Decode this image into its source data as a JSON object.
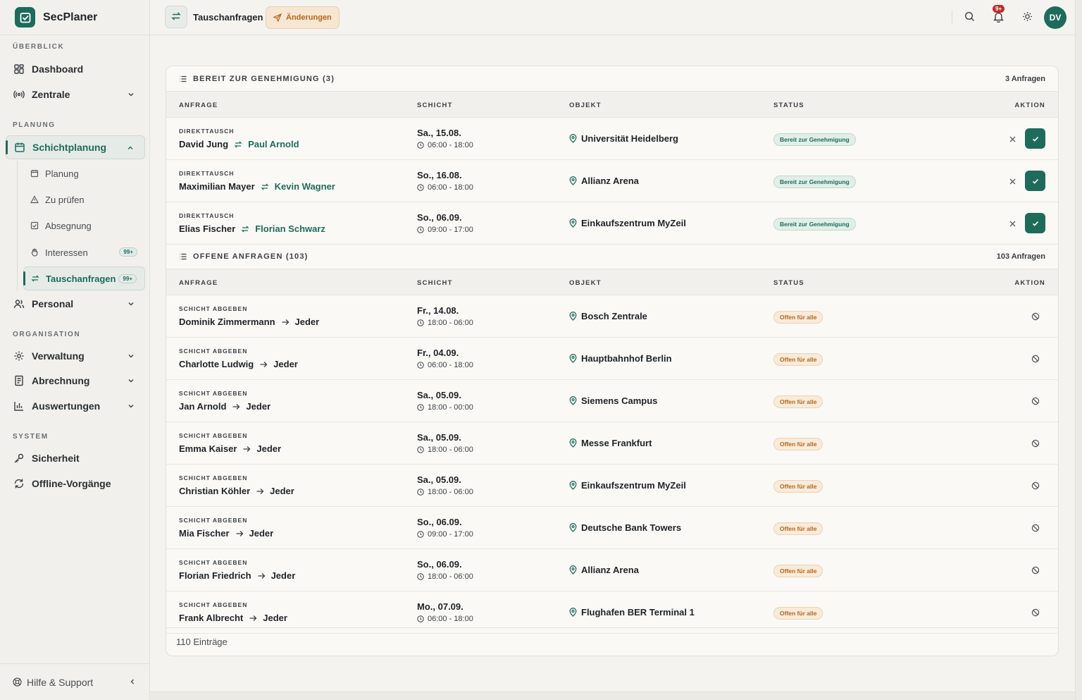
{
  "app": {
    "name": "SecPlaner"
  },
  "sidebar": {
    "sections": [
      {
        "label": "ÜBERBLICK"
      },
      {
        "label": "PLANUNG"
      },
      {
        "label": "ORGANISATION"
      },
      {
        "label": "SYSTEM"
      }
    ],
    "items": {
      "dashboard": "Dashboard",
      "zentrale": "Zentrale",
      "schichtplanung": "Schichtplanung",
      "personal": "Personal",
      "verwaltung": "Verwaltung",
      "abrechnung": "Abrechnung",
      "auswertungen": "Auswertungen",
      "sicherheit": "Sicherheit",
      "offline": "Offline-Vorgänge"
    },
    "subitems": {
      "planung": "Planung",
      "zu_pruefen": "Zu prüfen",
      "absegnung": "Absegnung",
      "interessen": "Interessen",
      "interessen_badge": "99+",
      "tauschanfragen": "Tauschanfragen",
      "tauschanfragen_badge": "99+"
    },
    "help": "Hilfe & Support"
  },
  "topbar": {
    "title": "Tauschanfragen",
    "changes": "Änderungen",
    "notif_badge": "9+",
    "avatar": "DV"
  },
  "columns": {
    "anfrage": "ANFRAGE",
    "schicht": "SCHICHT",
    "objekt": "OBJEKT",
    "status": "STATUS",
    "aktion": "AKTION"
  },
  "ready": {
    "title": "BEREIT ZUR GENEHMIGUNG (3)",
    "count": "3 Anfragen",
    "rows": [
      {
        "type": "DIREKTTAUSCH",
        "from": "David Jung",
        "to": "Paul Arnold",
        "date": "Sa., 15.08.",
        "time": "06:00 - 18:00",
        "object": "Universität Heidelberg",
        "status": "Bereit zur Genehmigung"
      },
      {
        "type": "DIREKTTAUSCH",
        "from": "Maximilian Mayer",
        "to": "Kevin Wagner",
        "date": "So., 16.08.",
        "time": "06:00 - 18:00",
        "object": "Allianz Arena",
        "status": "Bereit zur Genehmigung"
      },
      {
        "type": "DIREKTTAUSCH",
        "from": "Elias Fischer",
        "to": "Florian Schwarz",
        "date": "So., 06.09.",
        "time": "09:00 - 17:00",
        "object": "Einkaufszentrum MyZeil",
        "status": "Bereit zur Genehmigung"
      }
    ]
  },
  "open": {
    "title": "OFFENE ANFRAGEN (103)",
    "count": "103 Anfragen",
    "rows": [
      {
        "type": "SCHICHT ABGEBEN",
        "from": "Dominik Zimmermann",
        "to": "Jeder",
        "date": "Fr., 14.08.",
        "time": "18:00 - 06:00",
        "object": "Bosch Zentrale",
        "status": "Offen für alle"
      },
      {
        "type": "SCHICHT ABGEBEN",
        "from": "Charlotte Ludwig",
        "to": "Jeder",
        "date": "Fr., 04.09.",
        "time": "06:00 - 18:00",
        "object": "Hauptbahnhof Berlin",
        "status": "Offen für alle"
      },
      {
        "type": "SCHICHT ABGEBEN",
        "from": "Jan Arnold",
        "to": "Jeder",
        "date": "Sa., 05.09.",
        "time": "18:00 - 00:00",
        "object": "Siemens Campus",
        "status": "Offen für alle"
      },
      {
        "type": "SCHICHT ABGEBEN",
        "from": "Emma Kaiser",
        "to": "Jeder",
        "date": "Sa., 05.09.",
        "time": "18:00 - 06:00",
        "object": "Messe Frankfurt",
        "status": "Offen für alle"
      },
      {
        "type": "SCHICHT ABGEBEN",
        "from": "Christian Köhler",
        "to": "Jeder",
        "date": "Sa., 05.09.",
        "time": "18:00 - 06:00",
        "object": "Einkaufszentrum MyZeil",
        "status": "Offen für alle"
      },
      {
        "type": "SCHICHT ABGEBEN",
        "from": "Mia Fischer",
        "to": "Jeder",
        "date": "So., 06.09.",
        "time": "09:00 - 17:00",
        "object": "Deutsche Bank Towers",
        "status": "Offen für alle"
      },
      {
        "type": "SCHICHT ABGEBEN",
        "from": "Florian Friedrich",
        "to": "Jeder",
        "date": "So., 06.09.",
        "time": "18:00 - 06:00",
        "object": "Allianz Arena",
        "status": "Offen für alle"
      },
      {
        "type": "SCHICHT ABGEBEN",
        "from": "Frank Albrecht",
        "to": "Jeder",
        "date": "Mo., 07.09.",
        "time": "06:00 - 18:00",
        "object": "Flughafen BER Terminal 1",
        "status": "Offen für alle"
      }
    ]
  },
  "footer": {
    "entries": "110 Einträge"
  },
  "colors": {
    "accent": "#1e6b5c",
    "warning": "#b5651d",
    "danger": "#c62828"
  }
}
